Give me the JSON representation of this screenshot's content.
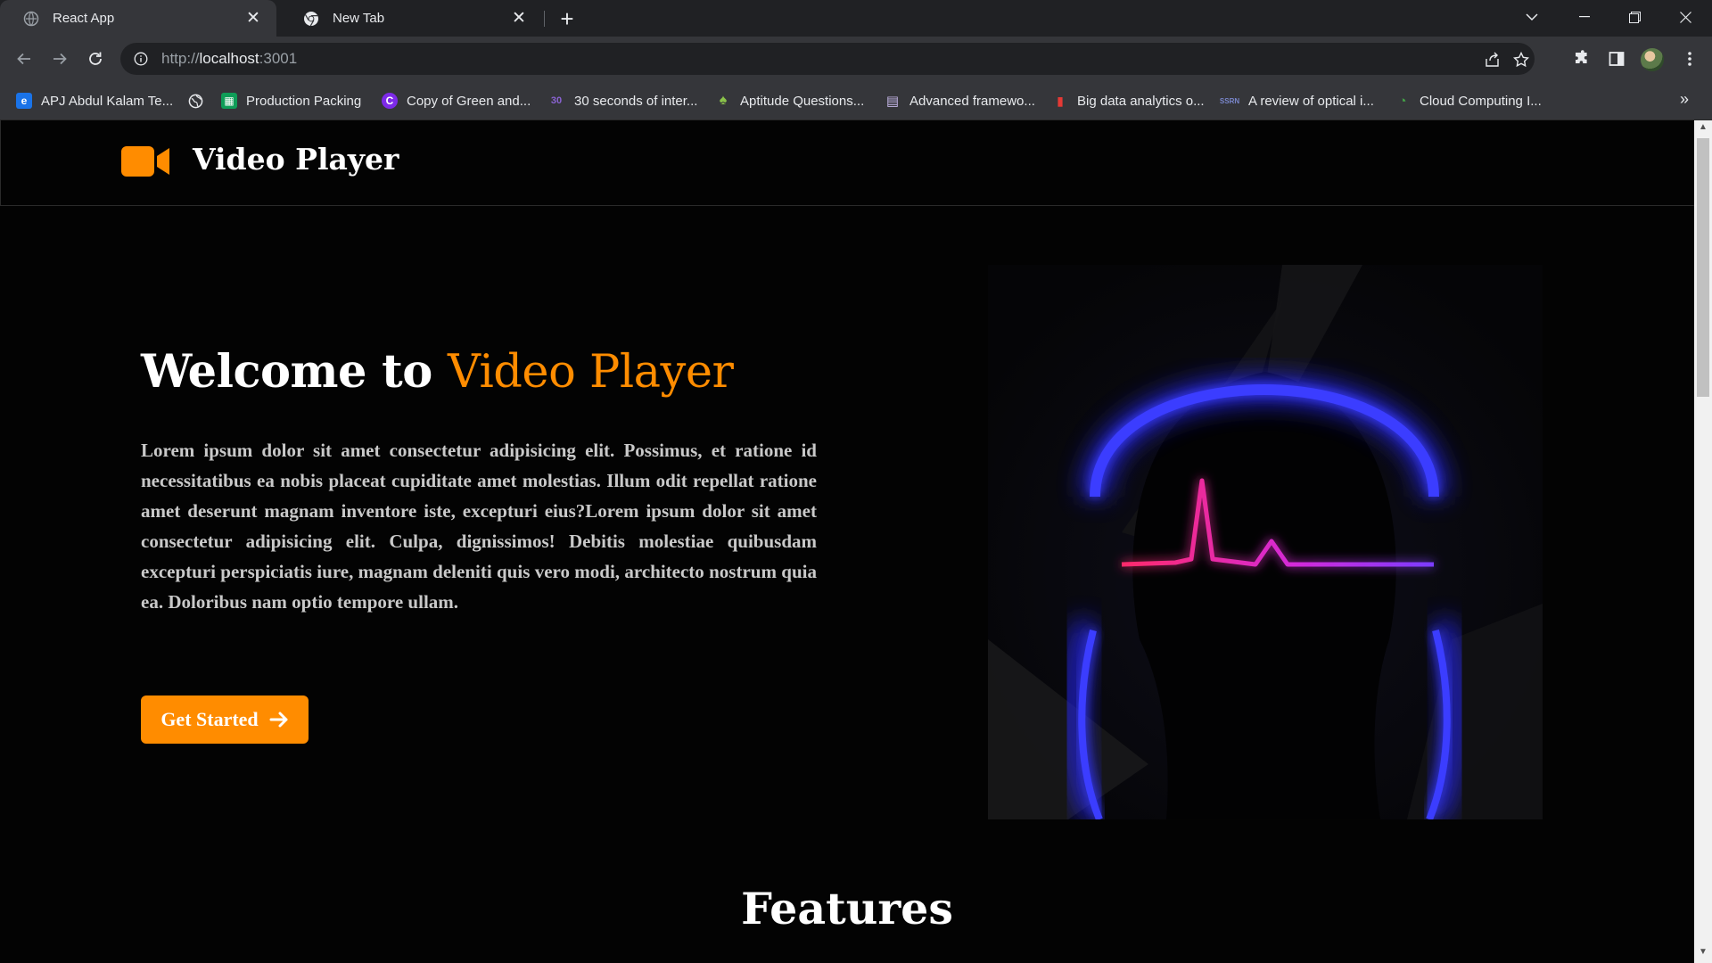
{
  "browser": {
    "tabs": [
      {
        "title": "React App",
        "active": true
      },
      {
        "title": "New Tab",
        "active": false
      }
    ],
    "close_glyph": "✕",
    "new_tab_glyph": "+",
    "url": {
      "protocol": "http://",
      "host": "localhost",
      "port": ":3001"
    },
    "bookmarks": [
      {
        "label": "APJ Abdul Kalam Te...",
        "icon": "e-icon",
        "color": "#1a73e8",
        "glyph": "e"
      },
      {
        "label": "",
        "icon": "globe-icon",
        "color": "#9aa0a6",
        "glyph": ""
      },
      {
        "label": "Production Packing",
        "icon": "sheet-icon",
        "color": "#0f9d58",
        "glyph": "▦"
      },
      {
        "label": "Copy of Green and...",
        "icon": "canva-icon",
        "color": "#7d2ae8",
        "glyph": "C"
      },
      {
        "label": "30 seconds of inter...",
        "icon": "thirty-icon",
        "color": "#6f42c1",
        "glyph": "30"
      },
      {
        "label": "Aptitude Questions...",
        "icon": "aptitude-icon",
        "color": "#8bc34a",
        "glyph": "♠"
      },
      {
        "label": "Advanced framewo...",
        "icon": "ieee-icon",
        "color": "#b0a0d0",
        "glyph": "▤"
      },
      {
        "label": "Big data analytics o...",
        "icon": "bigdata-icon",
        "color": "#e53935",
        "glyph": "▮"
      },
      {
        "label": "A review of optical i...",
        "icon": "ssrn-icon",
        "color": "#3f51b5",
        "glyph": "SSRN"
      },
      {
        "label": "Cloud Computing I...",
        "icon": "cloud-icon",
        "color": "#43a047",
        "glyph": "◔"
      }
    ],
    "more_glyph": "»"
  },
  "page": {
    "brand": "Video Player",
    "hero": {
      "title_prefix": "Welcome to ",
      "title_accent": "Video Player",
      "body": "Lorem ipsum dolor sit amet consectetur adipisicing elit. Possimus, et ratione id necessitatibus ea nobis placeat cupiditate amet molestias. Illum odit repellat ratione amet deserunt magnam inventore iste, excepturi eius?Lorem ipsum dolor sit amet consectetur adipisicing elit. Culpa, dignissimos! Debitis molestiae quibusdam excepturi perspiciatis iure, magnam deleniti quis vero modi, architecto nostrum quia ea. Doloribus nam optio tempore ullam.",
      "cta_label": "Get Started"
    },
    "features_heading": "Features",
    "colors": {
      "accent": "#ff8c00",
      "background": "#030303",
      "neon_blue": "#2a2cff",
      "neon_pink": "#ff2a8a"
    }
  }
}
